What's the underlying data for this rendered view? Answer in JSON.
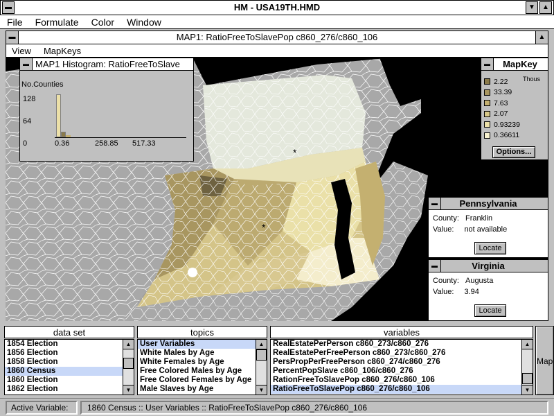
{
  "app": {
    "title": "HM - USA19TH.HMD",
    "menu": [
      "File",
      "Formulate",
      "Color",
      "Window"
    ]
  },
  "map_window": {
    "title": "MAP1: RatioFreeToSlavePop c860_276/c860_106",
    "menu": [
      "View",
      "MapKeys"
    ]
  },
  "histogram": {
    "title": "MAP1 Histogram: RatioFreeToSlave",
    "ylabel": "No.Counties",
    "yticks": [
      "128",
      "64",
      "0"
    ],
    "xticks": [
      "0.36",
      "258.85",
      "517.33"
    ]
  },
  "mapkey": {
    "title": "MapKey",
    "unit": "Thous",
    "items": [
      {
        "label": "2.22",
        "color": "#8a7a4a"
      },
      {
        "label": "33.39",
        "color": "#a89660"
      },
      {
        "label": "7.63",
        "color": "#c4b070"
      },
      {
        "label": "2.07",
        "color": "#d8c888"
      },
      {
        "label": "0.93239",
        "color": "#ece0a8"
      },
      {
        "label": "0.36611",
        "color": "#f8f2d0"
      }
    ],
    "options_label": "Options..."
  },
  "info_pa": {
    "title": "Pennsylvania",
    "county_label": "County:",
    "county_value": "Franklin",
    "value_label": "Value:",
    "value_value": "not available",
    "locate_label": "Locate"
  },
  "info_va": {
    "title": "Virginia",
    "county_label": "County:",
    "county_value": "Augusta",
    "value_label": "Value:",
    "value_value": "3.94",
    "locate_label": "Locate"
  },
  "data_set": {
    "title": "data set",
    "items": [
      "1854 Election",
      "1856 Election",
      "1858 Election",
      "1860 Census",
      "1860 Election",
      "1862 Election"
    ],
    "selected": 3
  },
  "topics": {
    "title": "topics",
    "items": [
      "User Variables",
      "White Males by Age",
      "White Females by Age",
      "Free Colored Males by Age",
      "Free Colored Females by Age",
      "Male Slaves by Age"
    ],
    "selected": 0
  },
  "variables": {
    "title": "variables",
    "items": [
      "RealEstatePerPerson c860_273/c860_276",
      "RealEstatePerFreePerson c860_273/c860_276",
      "PersPropPerFreePerson c860_274/c860_276",
      "PercentPopSlave c860_106/c860_276",
      "RationFreeToSlavePop c860_276/c860_106",
      "RatioFreeToSlavePop c860_276/c860_106"
    ],
    "selected": 5
  },
  "map_button": {
    "label": "Map"
  },
  "status": {
    "label": "Active Variable:",
    "value": "1860 Census :: User Variables :: RatioFreeToSlavePop c860_276/c860_106"
  }
}
